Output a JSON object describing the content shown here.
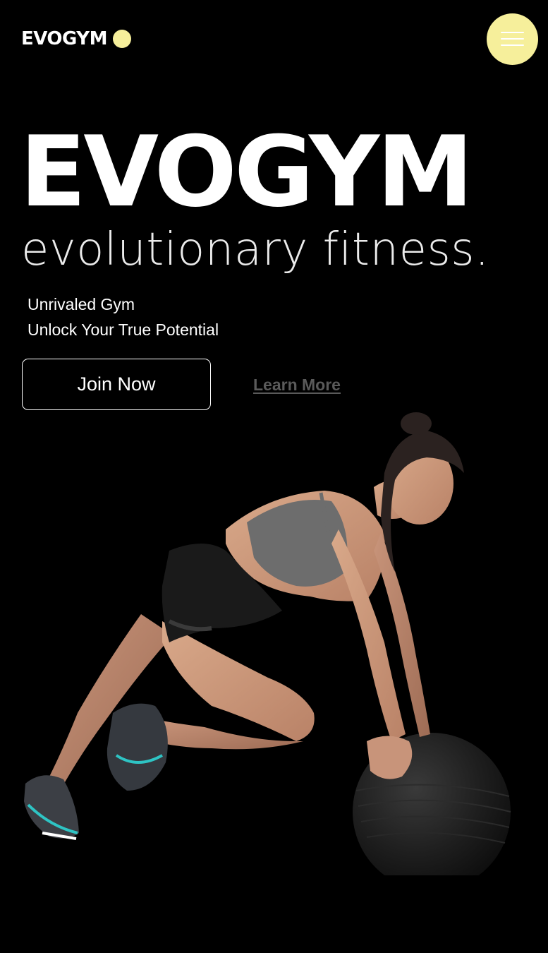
{
  "header": {
    "logo_text": "EVOGYM",
    "logo_accent_color": "#f6ef9b",
    "menu_icon": "hamburger-menu-icon"
  },
  "hero": {
    "title": "EVOGYM",
    "subtitle": "evolutionary fitness.",
    "tagline_line1": "Unrivaled Gym",
    "tagline_line2": "Unlock Your True Potential",
    "join_label": "Join Now",
    "learn_more_label": "Learn More",
    "image_subject": "woman-athlete-medicine-ball"
  },
  "colors": {
    "background": "#000000",
    "accent": "#f6ef9b",
    "text": "#ffffff",
    "link": "#5a5a5a"
  }
}
